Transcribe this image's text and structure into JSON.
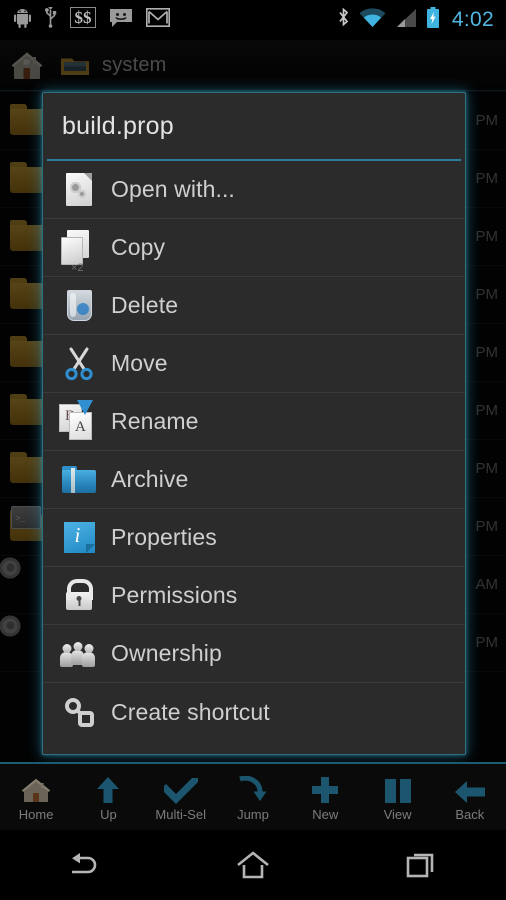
{
  "status_bar": {
    "time": "4:02",
    "left_icons": [
      {
        "name": "android-robot-icon"
      },
      {
        "name": "usb-icon"
      },
      {
        "name": "dollar-dollar-icon"
      },
      {
        "name": "messaging-smiley-icon"
      },
      {
        "name": "gmail-icon"
      }
    ],
    "right_icons": [
      {
        "name": "bluetooth-icon"
      },
      {
        "name": "wifi-icon"
      },
      {
        "name": "cell-signal-icon"
      },
      {
        "name": "battery-charging-icon"
      }
    ],
    "accent_color": "#51b6e0"
  },
  "action_bar": {
    "home_icon": "home-icon",
    "folder_icon": "open-folder-icon",
    "title": "system"
  },
  "file_list": {
    "rows": [
      {
        "icon": "folder-icon",
        "time": "PM"
      },
      {
        "icon": "folder-icon",
        "time": "PM"
      },
      {
        "icon": "folder-icon",
        "time": "PM"
      },
      {
        "icon": "folder-icon",
        "time": "PM"
      },
      {
        "icon": "folder-icon",
        "time": "PM"
      },
      {
        "icon": "folder-icon",
        "time": "PM"
      },
      {
        "icon": "folder-icon",
        "time": "PM"
      },
      {
        "icon": "folder-terminal-icon",
        "time": "PM"
      },
      {
        "icon": "gear-document-icon",
        "time": "AM"
      },
      {
        "icon": "gear-document-icon",
        "time": "PM"
      }
    ]
  },
  "dialog": {
    "title": "build.prop",
    "rule_color": "#2e7d9e",
    "border_color": "#2f707f",
    "items": [
      {
        "label": "Open with...",
        "icon": "open-with-icon"
      },
      {
        "label": "Copy",
        "icon": "copy-icon"
      },
      {
        "label": "Delete",
        "icon": "delete-trash-icon"
      },
      {
        "label": "Move",
        "icon": "move-scissors-icon"
      },
      {
        "label": "Rename",
        "icon": "rename-icon"
      },
      {
        "label": "Archive",
        "icon": "archive-zip-folder-icon"
      },
      {
        "label": "Properties",
        "icon": "properties-info-icon"
      },
      {
        "label": "Permissions",
        "icon": "permissions-lock-icon"
      },
      {
        "label": "Ownership",
        "icon": "ownership-people-icon"
      },
      {
        "label": "Create shortcut",
        "icon": "create-shortcut-link-icon"
      }
    ]
  },
  "toolbar": {
    "items": [
      {
        "label": "Home",
        "icon": "home-icon"
      },
      {
        "label": "Up",
        "icon": "arrow-up-icon"
      },
      {
        "label": "Multi-Sel",
        "icon": "checkmark-icon"
      },
      {
        "label": "Jump",
        "icon": "jump-arrow-icon"
      },
      {
        "label": "New",
        "icon": "plus-icon"
      },
      {
        "label": "View",
        "icon": "view-grid-icon"
      },
      {
        "label": "Back",
        "icon": "arrow-left-icon"
      }
    ]
  },
  "nav_bar": {
    "items": [
      {
        "name": "nav-back-icon"
      },
      {
        "name": "nav-home-icon"
      },
      {
        "name": "nav-recents-icon"
      }
    ]
  }
}
